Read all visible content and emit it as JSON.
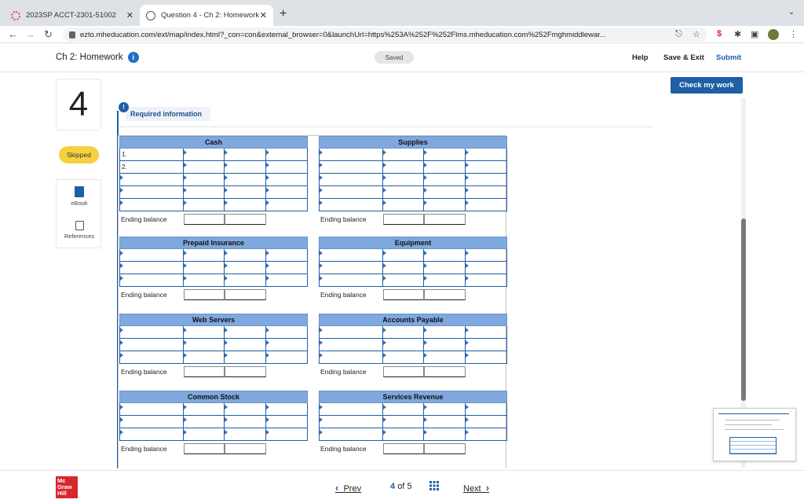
{
  "browser": {
    "tabs": [
      {
        "title": "2023SP ACCT-2301-51002",
        "close": "✕"
      },
      {
        "title": "Question 4 - Ch 2: Homework",
        "close": "✕"
      }
    ],
    "new_tab": "+",
    "url": "ezto.mheducation.com/ext/map/index.html?_con=con&external_browser=0&launchUrl=https%253A%252F%252Flms.mheducation.com%252Fmghmiddlewar..."
  },
  "header": {
    "title": "Ch 2: Homework",
    "info_icon": "i",
    "saved": "Saved",
    "help": "Help",
    "save_exit": "Save & Exit",
    "submit": "Submit"
  },
  "rail": {
    "question_number": "4",
    "status": "Skipped",
    "ebook": "eBook",
    "references": "References"
  },
  "check_my_work": "Check my work",
  "required": {
    "badge": "!",
    "label": "Required information"
  },
  "ledger": {
    "ending_label": "Ending balance",
    "accounts": [
      {
        "name": "Cash",
        "rows": [
          "1.",
          "2.",
          "",
          "",
          ""
        ]
      },
      {
        "name": "Supplies",
        "rows": [
          "",
          "",
          "",
          "",
          ""
        ]
      },
      {
        "name": "Prepaid Insurance",
        "rows": [
          "",
          "",
          ""
        ]
      },
      {
        "name": "Equipment",
        "rows": [
          "",
          "",
          ""
        ]
      },
      {
        "name": "Web Servers",
        "rows": [
          "",
          "",
          ""
        ]
      },
      {
        "name": "Accounts Payable",
        "rows": [
          "",
          "",
          ""
        ]
      },
      {
        "name": "Common Stock",
        "rows": [
          "",
          "",
          ""
        ]
      },
      {
        "name": "Services Revenue",
        "rows": [
          "",
          "",
          ""
        ]
      }
    ]
  },
  "footer": {
    "logo": "Mc Graw Hill",
    "prev": "Prev",
    "page_current": "4",
    "page_of": "of",
    "page_total": "5",
    "next": "Next"
  }
}
